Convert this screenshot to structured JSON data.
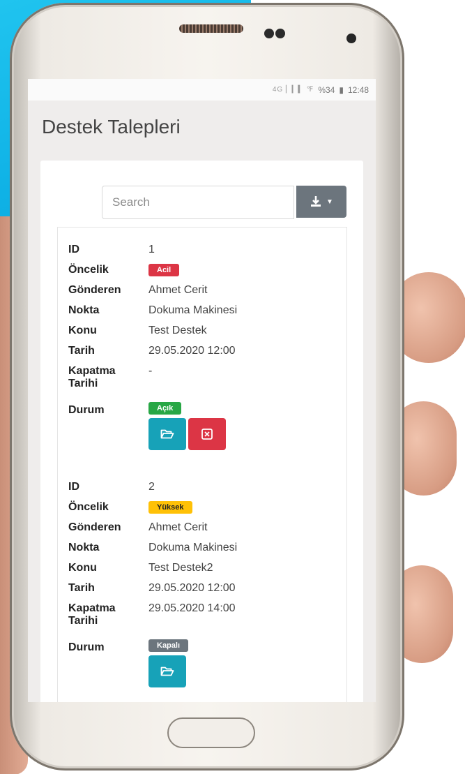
{
  "status_bar": {
    "icons": "4G ▏▎▍ ℉",
    "battery": "%34",
    "time": "12:48"
  },
  "page": {
    "title": "Destek Talepleri"
  },
  "search": {
    "placeholder": "Search"
  },
  "labels": {
    "id": "ID",
    "priority": "Öncelik",
    "sender": "Gönderen",
    "point": "Nokta",
    "subject": "Konu",
    "date": "Tarih",
    "closing_date_1": "Kapatma",
    "closing_date_2": "Tarihi",
    "status": "Durum"
  },
  "tickets": [
    {
      "id": "1",
      "priority": "Acil",
      "priority_color": "#dc3545",
      "sender": "Ahmet Cerit",
      "point": "Dokuma Makinesi",
      "subject": "Test Destek",
      "date": "29.05.2020 12:00",
      "closing_date": "-",
      "status": "Açık",
      "status_color": "#28a745",
      "actions": [
        "folder-open-icon",
        "close-square-icon"
      ]
    },
    {
      "id": "2",
      "priority": "Yüksek",
      "priority_color": "#ffc107",
      "sender": "Ahmet Cerit",
      "point": "Dokuma Makinesi",
      "subject": "Test Destek2",
      "date": "29.05.2020 12:00",
      "closing_date": "29.05.2020 14:00",
      "status": "Kapalı",
      "status_color": "#6c757d",
      "actions": [
        "folder-open-icon"
      ]
    }
  ]
}
